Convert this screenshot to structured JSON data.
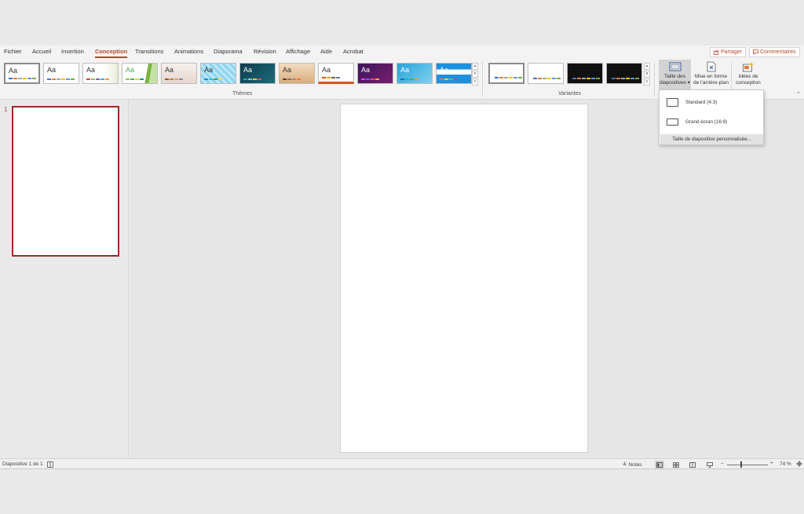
{
  "tabs": [
    "Fichier",
    "Accueil",
    "Insertion",
    "Conception",
    "Transitions",
    "Animations",
    "Diaporama",
    "Révision",
    "Affichage",
    "Aide",
    "Acrobat"
  ],
  "active_tab": "Conception",
  "header_buttons": {
    "share": "Partager",
    "comments": "Commentaires"
  },
  "ribbon": {
    "themes_group_label": "Thèmes",
    "variants_group_label": "Variantes",
    "theme_sample_text": "Aa",
    "slide_size_button": {
      "line1": "Taille des",
      "line2": "diapositives ▾"
    },
    "format_background_button": {
      "line1": "Mise en forme",
      "line2": "de l'arrière-plan"
    },
    "design_ideas_button": {
      "line1": "Idées de",
      "line2": "conception"
    }
  },
  "dropdown": {
    "standard": "Standard (4:3)",
    "widescreen": "Grand écran (16:9)",
    "custom": "Taille de diapositive personnalisée..."
  },
  "slide_pane": {
    "slide_number": "1"
  },
  "status": {
    "slide_info": "Diapositive 1 de 1",
    "notes": "Notes",
    "zoom_minus": "–",
    "zoom_plus": "+",
    "zoom_level": "74 %"
  },
  "colors": {
    "accent": "#b7472a",
    "selection_border": "#9a2b2b"
  },
  "icons": [
    "share-icon",
    "comment-icon",
    "slide-size-icon",
    "format-background-icon",
    "design-ideas-icon",
    "accessibility-icon",
    "notes-icon",
    "normal-view-icon",
    "slide-sorter-icon",
    "reading-view-icon",
    "slideshow-icon",
    "fit-slide-icon",
    "collapse-ribbon-icon"
  ]
}
